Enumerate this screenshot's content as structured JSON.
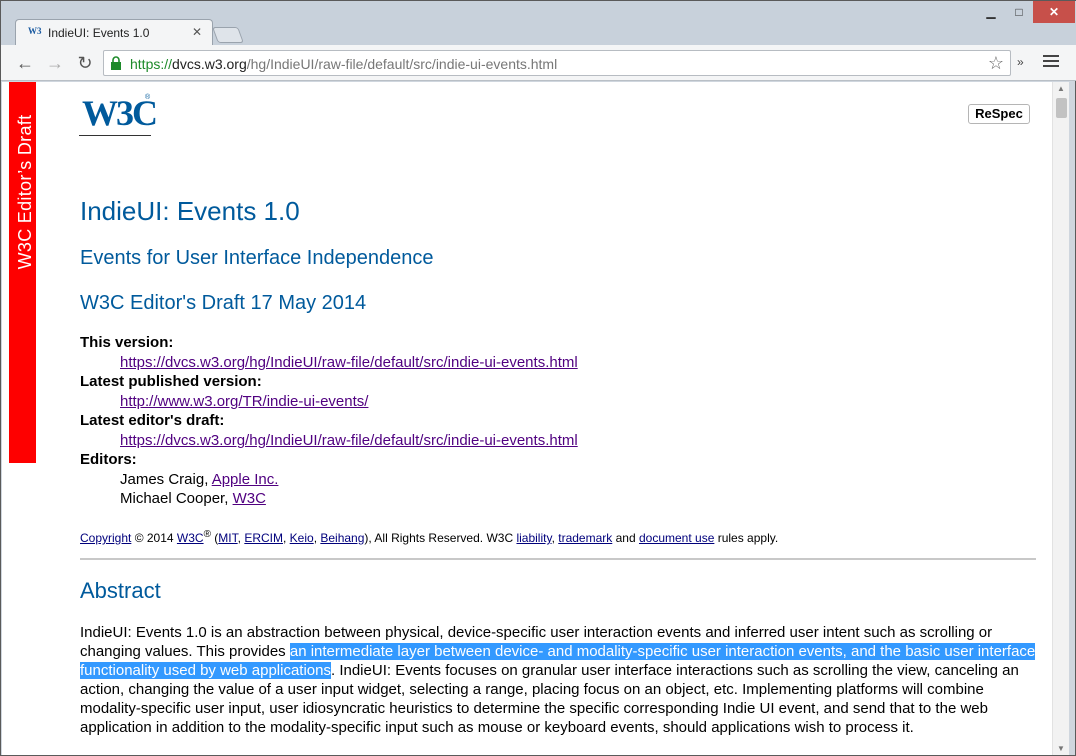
{
  "browser": {
    "tab_title": "IndieUI: Events 1.0",
    "tab_favicon": "W3",
    "url_https": "https://",
    "url_host": "dvcs.w3.org",
    "url_path": "/hg/IndieUI/raw-file/default/src/indie-ui-events.html"
  },
  "page": {
    "ribbon": "W3C Editor’s Draft",
    "logo": "W3C",
    "respec_button": "ReSpec",
    "title": "IndieUI: Events 1.0",
    "subtitle": "Events for User Interface Independence",
    "draft_date": "W3C Editor's Draft 17 May 2014",
    "this_version_label": "This version:",
    "this_version_link": "https://dvcs.w3.org/hg/IndieUI/raw-file/default/src/indie-ui-events.html",
    "latest_published_label": "Latest published version:",
    "latest_published_link": "http://www.w3.org/TR/indie-ui-events/",
    "latest_editors_label": "Latest editor's draft:",
    "latest_editors_link": "https://dvcs.w3.org/hg/IndieUI/raw-file/default/src/indie-ui-events.html",
    "editors_label": "Editors:",
    "editor1_name": "James Craig, ",
    "editor1_org": "Apple Inc.",
    "editor2_name": "Michael Cooper, ",
    "editor2_org": "W3C",
    "copyright": {
      "copyright_link": "Copyright",
      "year": " © 2014 ",
      "w3c": "W3C",
      "reg": "®",
      "open": " (",
      "mit": "MIT",
      "ercim": "ERCIM",
      "keio": "Keio",
      "beihang": "Beihang",
      "rights": "), All Rights Reserved. W3C ",
      "liability": "liability",
      "trademark": "trademark",
      "and": " and ",
      "document_use": "document use",
      "rules": " rules apply."
    },
    "abstract_heading": "Abstract",
    "abstract_part1": "IndieUI: Events 1.0 is an abstraction between physical, device-specific user interaction events and inferred user intent such as scrolling or changing values. This provides ",
    "abstract_highlight": "an intermediate layer between device- and modality-specific user interaction events, and the basic user interface functionality used by web applications",
    "abstract_part2": ". IndieUI: Events focuses on granular user interface interactions such as scrolling the view, canceling an action, changing the value of a user input widget, selecting a range, placing focus on an object, etc. Implementing platforms will combine modality-specific user input, user idiosyncratic heuristics to determine the specific corresponding Indie UI event, and send that to the web application in addition to the modality-specific input such as mouse or keyboard events, should applications wish to process it."
  }
}
